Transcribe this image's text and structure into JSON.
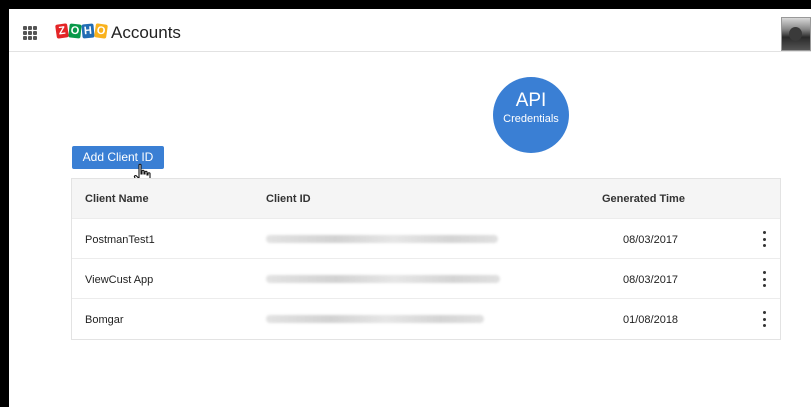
{
  "header": {
    "logo_letters": [
      "Z",
      "O",
      "H",
      "O"
    ],
    "logo_colors": [
      "#e42527",
      "#089949",
      "#226db4",
      "#f9b21d"
    ],
    "app_title": "Accounts",
    "apps_icon": "grid-icon",
    "avatar_icon": "user-avatar"
  },
  "badge": {
    "title": "API",
    "subtitle": "Credentials",
    "color": "#3a7fd4"
  },
  "actions": {
    "add_client_label": "Add Client ID"
  },
  "table": {
    "headers": {
      "name": "Client Name",
      "id": "Client ID",
      "time": "Generated Time"
    },
    "rows": [
      {
        "name": "PostmanTest1",
        "time": "08/03/2017"
      },
      {
        "name": "ViewCust App",
        "time": "08/03/2017"
      },
      {
        "name": "Bomgar",
        "time": "01/08/2018"
      }
    ]
  }
}
